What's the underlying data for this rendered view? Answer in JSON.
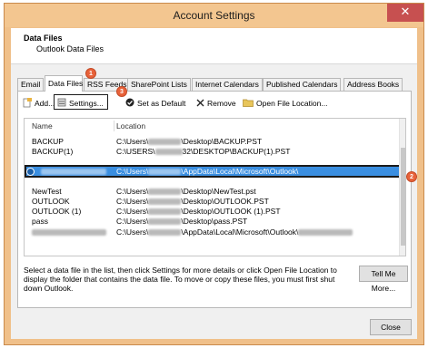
{
  "window": {
    "title": "Account Settings",
    "close_glyph": "✕"
  },
  "header": {
    "title": "Data Files",
    "subtitle": "Outlook Data Files"
  },
  "tabs": [
    {
      "label": "Email"
    },
    {
      "label": "Data Files"
    },
    {
      "label": "RSS Feeds"
    },
    {
      "label": "SharePoint Lists"
    },
    {
      "label": "Internet Calendars"
    },
    {
      "label": "Published Calendars"
    },
    {
      "label": "Address Books"
    }
  ],
  "toolbar": {
    "add_label": "Add...",
    "settings_label": "Settings...",
    "default_label": "Set as Default",
    "remove_label": "Remove",
    "open_label": "Open File Location..."
  },
  "list": {
    "col_name": "Name",
    "col_location": "Location",
    "rows": [
      {
        "name": "BACKUP",
        "loc_a": "C:\\Users\\",
        "loc_b": "\\Desktop\\BACKUP.PST"
      },
      {
        "name": "BACKUP(1)",
        "loc_a": "C:\\USERS\\",
        "loc_b": "32\\DESKTOP\\BACKUP(1).PST"
      },
      {
        "name": "",
        "loc_a": "C:\\Users\\",
        "loc_b": "\\AppData\\Local\\Microsoft\\Outlook\\"
      },
      {
        "name": "NewTest",
        "loc_a": "C:\\Users\\",
        "loc_b": "\\Desktop\\NewTest.pst"
      },
      {
        "name": "OUTLOOK",
        "loc_a": "C:\\Users\\",
        "loc_b": "\\Desktop\\OUTLOOK.PST"
      },
      {
        "name": "OUTLOOK (1)",
        "loc_a": "C:\\Users\\",
        "loc_b": "\\Desktop\\OUTLOOK (1).PST"
      },
      {
        "name": "pass",
        "loc_a": "C:\\Users\\",
        "loc_b": "\\Desktop\\pass.PST"
      },
      {
        "name": "",
        "loc_a": "C:\\Users\\",
        "loc_b": "\\AppData\\Local\\Microsoft\\Outlook\\"
      }
    ]
  },
  "callouts": [
    "1",
    "2",
    "3"
  ],
  "description": "Select a data file in the list, then click Settings for more details or click Open File Location to display the folder that contains the data file. To move or copy these files, you must first shut down Outlook.",
  "buttons": {
    "tell_me": "Tell Me More...",
    "close": "Close"
  },
  "colors": {
    "titlebar": "#f3c690",
    "selection": "#3a8ee0",
    "callout": "#e8623a",
    "close_button": "#c75050"
  }
}
